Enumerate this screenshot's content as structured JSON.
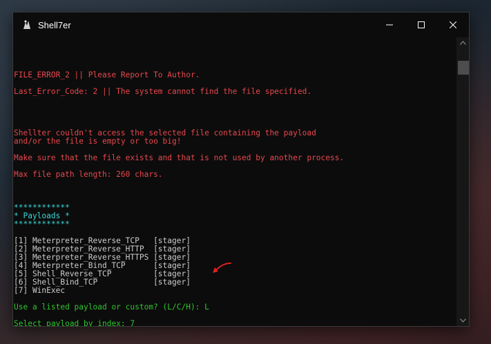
{
  "window": {
    "title": "Shell7er"
  },
  "console": {
    "error_lines": [
      "FILE_ERROR_2 || Please Report To Author.",
      "Last_Error_Code: 2 || The system cannot find the file specified.",
      "Shellter couldn't access the selected file containing the payload",
      "and/or the file is empty or too big!",
      "Make sure that the file exists and that is not used by another process.",
      "Max file path length: 260 chars."
    ],
    "banner": [
      "************",
      "* Payloads *",
      "************"
    ],
    "payloads": [
      "[1] Meterpreter_Reverse_TCP   [stager]",
      "[2] Meterpreter_Reverse_HTTP  [stager]",
      "[3] Meterpreter_Reverse_HTTPS [stager]",
      "[4] Meterpreter_Bind_TCP      [stager]",
      "[5] Shell_Reverse_TCP         [stager]",
      "[6] Shell_Bind_TCP            [stager]",
      "[7] WinExec"
    ],
    "prompts": [
      "Use a listed payload or custom? (L/C/H): L",
      "Select payload by index: 7"
    ]
  },
  "icons": {
    "app": "shellter-app-icon",
    "minimize": "minimize-icon",
    "maximize": "maximize-icon",
    "close": "close-icon",
    "annotation": "red-arrow-icon"
  },
  "colors": {
    "error_text": "#e8474d",
    "banner_text": "#3bd6d6",
    "menu_text": "#cccccc",
    "prompt_text": "#2ec52e",
    "annotation_arrow": "#e02020"
  }
}
